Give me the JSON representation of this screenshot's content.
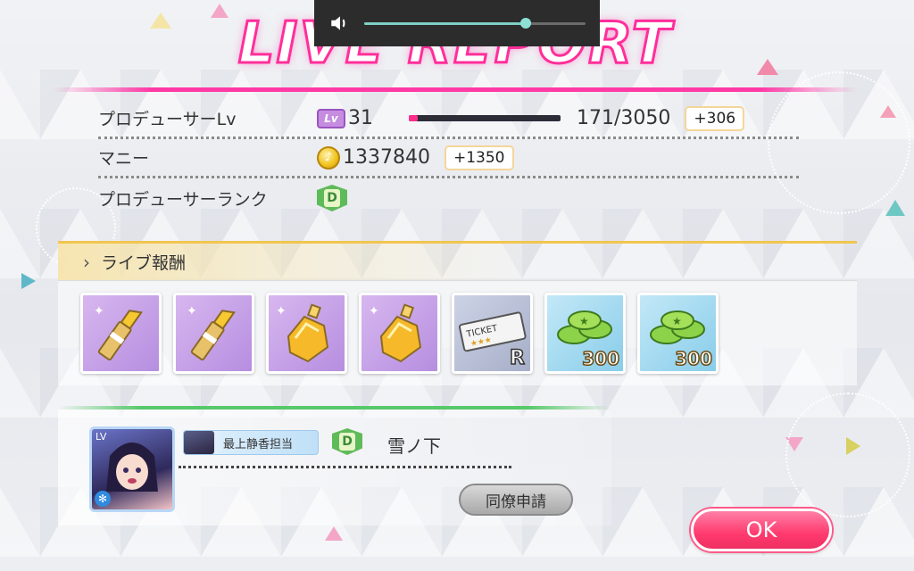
{
  "title": "LIVE REPORT",
  "volume": {
    "level": 0.73,
    "icon": "speaker-icon"
  },
  "stats": {
    "producer_lv": {
      "label": "プロデューサーLv",
      "badge": "Lv",
      "value": "31",
      "exp_progress": 0.056,
      "exp_text": "171/3050",
      "gain": "+306"
    },
    "money": {
      "label": "マニー",
      "coin_icon": "coin-icon",
      "value": "1337840",
      "gain": "+1350"
    },
    "rank": {
      "label": "プロデューサーランク",
      "rank": "D"
    }
  },
  "rewards": {
    "header": "ライブ報酬",
    "items": [
      {
        "name": "lipstick-item",
        "icon": "lipstick-icon",
        "bg": "purple"
      },
      {
        "name": "lipstick-item",
        "icon": "lipstick-icon",
        "bg": "purple"
      },
      {
        "name": "perfume-item",
        "icon": "perfume-bottle-icon",
        "bg": "purple"
      },
      {
        "name": "perfume-item",
        "icon": "perfume-bottle-icon",
        "bg": "purple"
      },
      {
        "name": "ticket-item",
        "icon": "ticket-icon",
        "bg": "gray",
        "ticket_text": "TICKET",
        "rarity": "R"
      },
      {
        "name": "coins-item",
        "icon": "star-coins-icon",
        "bg": "blue",
        "count": "300"
      },
      {
        "name": "coins-item",
        "icon": "star-coins-icon",
        "bg": "blue",
        "count": "300"
      }
    ]
  },
  "producer": {
    "avatar_lv": "LV",
    "tag": "最上静香担当",
    "rank": "D",
    "name": "雪ノ下",
    "colleague_button": "同僚申請"
  },
  "ok_button": "OK",
  "colors": {
    "title_pink": "#ff2e9a",
    "exp_fill": "#ff2e8a",
    "ok_button": "#ff3a6e",
    "rank_green": "#5fba5a"
  }
}
